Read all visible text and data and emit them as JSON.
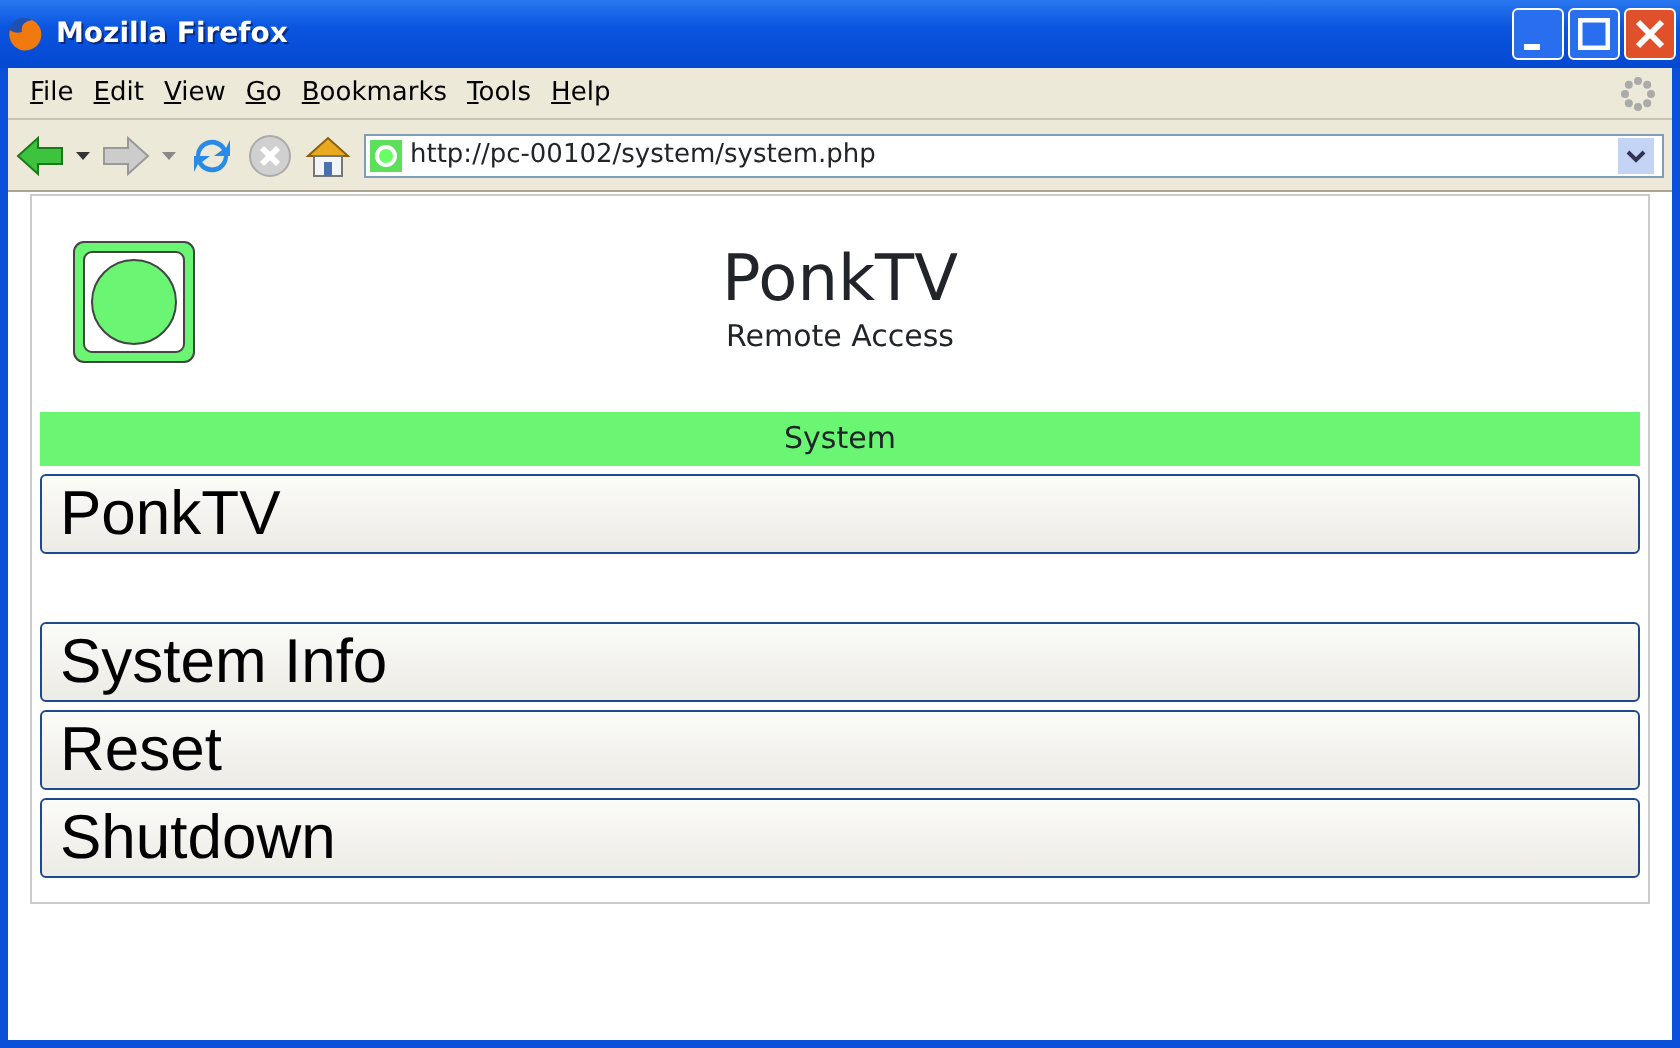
{
  "window": {
    "title": "Mozilla Firefox"
  },
  "menu": [
    "File",
    "Edit",
    "View",
    "Go",
    "Bookmarks",
    "Tools",
    "Help"
  ],
  "address": {
    "value": "http://pc-00102/system/system.php"
  },
  "page": {
    "title": "PonkTV",
    "subtitle": "Remote Access",
    "section": "System",
    "button_groups": [
      [
        "PonkTV"
      ],
      [
        "System Info",
        "Reset",
        "Shutdown"
      ]
    ]
  }
}
